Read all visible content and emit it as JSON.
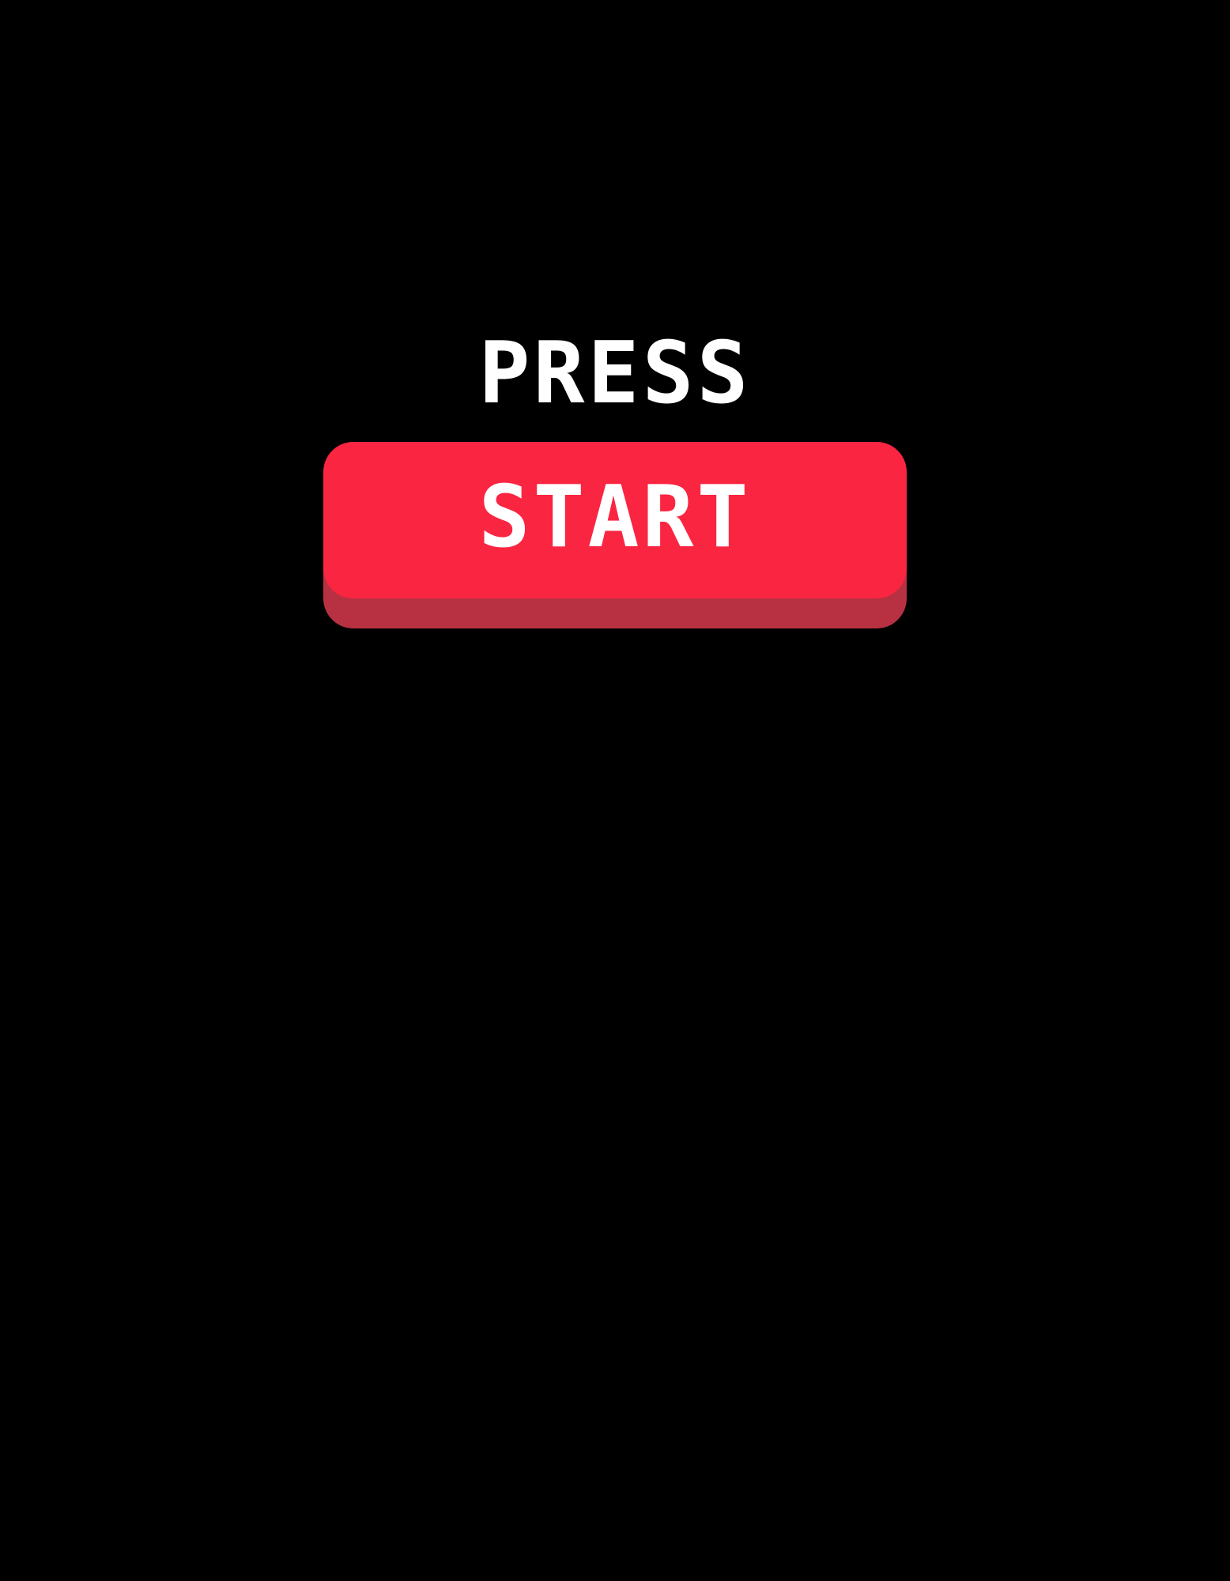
{
  "screen": {
    "background": "#000000"
  },
  "prompt": {
    "label": "PRESS"
  },
  "start_button": {
    "label": "START",
    "face_color": "#fa2541",
    "shadow_color": "#b73142",
    "text_color": "#ffffff"
  }
}
